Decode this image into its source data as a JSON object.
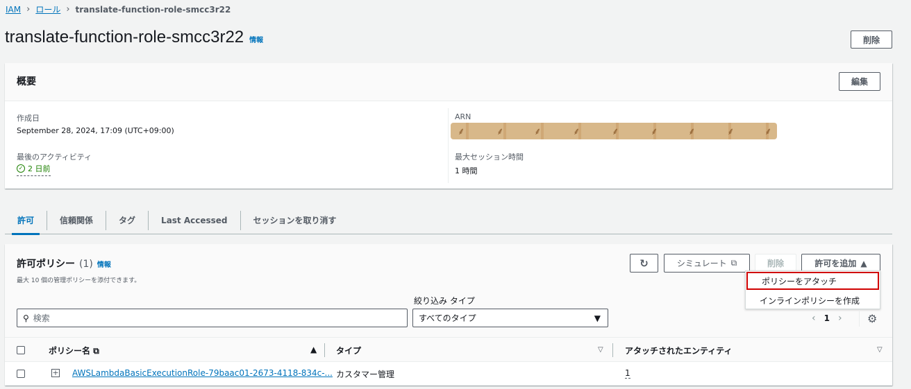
{
  "breadcrumb": {
    "root": "IAM",
    "roles": "ロール",
    "current": "translate-function-role-smcc3r22"
  },
  "header": {
    "title": "translate-function-role-smcc3r22",
    "info": "情報",
    "delete_label": "削除"
  },
  "summary": {
    "title": "概要",
    "edit_label": "編集",
    "created_label": "作成日",
    "created_value": "September 28, 2024, 17:09 (UTC+09:00)",
    "last_activity_label": "最後のアクティビティ",
    "last_activity_value": "2 日前",
    "arn_label": "ARN",
    "max_session_label": "最大セッション時間",
    "max_session_value": "1 時間"
  },
  "tabs": [
    {
      "label": "許可"
    },
    {
      "label": "信頼関係"
    },
    {
      "label": "タグ"
    },
    {
      "label": "Last Accessed"
    },
    {
      "label": "セッションを取り消す"
    }
  ],
  "policies": {
    "title": "許可ポリシー",
    "count": "(1)",
    "info": "情報",
    "subtitle": "最大 10 個の管理ポリシーを添付できます。",
    "simulate_label": "シミュレート",
    "delete_label": "削除",
    "add_label": "許可を追加",
    "filter_label": "絞り込み タイプ",
    "search_placeholder": "検索",
    "type_value": "すべてのタイプ",
    "page": "1",
    "columns": {
      "name": "ポリシー名",
      "type": "タイプ",
      "entities": "アタッチされたエンティティ"
    },
    "rows": [
      {
        "name": "AWSLambdaBasicExecutionRole-79baac01-2673-4118-834c-...",
        "type": "カスタマー管理",
        "entities": "1"
      }
    ]
  },
  "dropdown": {
    "attach": "ポリシーをアタッチ",
    "inline": "インラインポリシーを作成"
  },
  "colors": {
    "link": "#0073bb",
    "success": "#1d8102",
    "highlight": "#d00000"
  }
}
